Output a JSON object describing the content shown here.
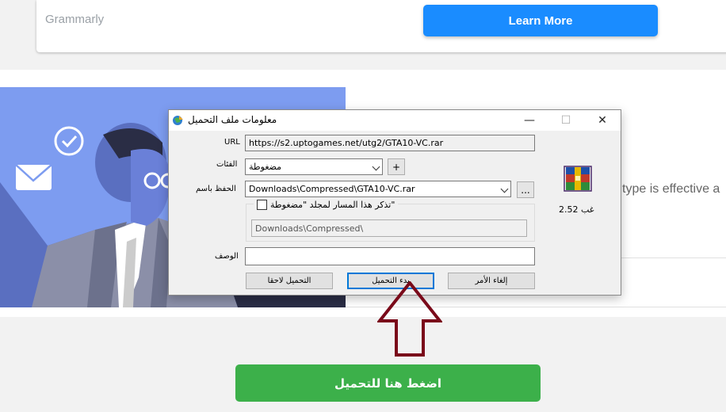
{
  "background_page": {
    "ad_brand": "Grammarly",
    "ad_button": "Learn More",
    "partial_text": "type is effective a",
    "download_button": "اضغط هنا للتحميل"
  },
  "dialog": {
    "title": "معلومات ملف التحميل",
    "url_label": "URL",
    "url_value": "https://s2.uptogames.net/utg2/GTA10-VC.rar",
    "category_label": "الفئات",
    "category_value": "مضغوطة",
    "add_category": "+",
    "save_as_label": "الحفظ باسم",
    "save_as_value": "Downloads\\Compressed\\GTA10-VC.rar",
    "browse": "...",
    "remember_path": "تذكر هذا المسار لمجلد \"مضغوطة\"",
    "path_value": "Downloads\\Compressed\\",
    "description_label": "الوصف",
    "description_value": "",
    "file_size": "2.52  غب",
    "download_later": "التحميل لاحقا",
    "start_download": "بدء التحميل",
    "cancel": "إلغاء الأمر"
  },
  "colors": {
    "ad_button": "#1a8cff",
    "download_button": "#3cb04a",
    "illustration_bg": "#7d9cf0",
    "arrow": "#7a0a1a"
  }
}
